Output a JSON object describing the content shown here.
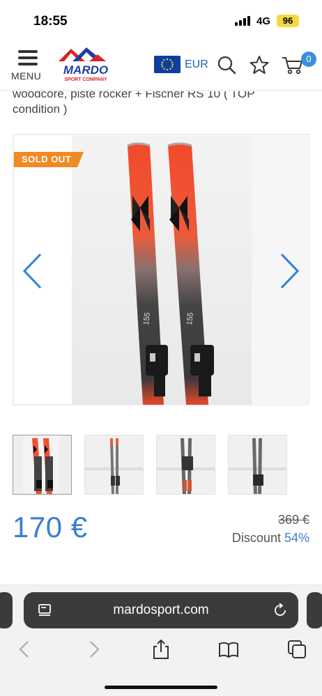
{
  "status_bar": {
    "time": "18:55",
    "network": "4G",
    "battery": "96"
  },
  "header": {
    "menu_label": "MENU",
    "logo_text": "MARDO",
    "logo_subtext": "SPORT COMPANY",
    "currency": "EUR",
    "cart_count": "0",
    "colors": {
      "accent": "#3a7fcf",
      "logo_red": "#d8232a",
      "logo_blue": "#1f3f9e"
    }
  },
  "product": {
    "title_line1": "woodcore, piste rocker + Fischer RS 10 ( TOP",
    "title_line2": "condition )",
    "badge": "SOLD OUT",
    "ski_length": "155",
    "price": "170 €",
    "old_price": "369 €",
    "discount_label": "Discount",
    "discount_value": "54%"
  },
  "gallery": {
    "prev_icon": "chevron-left-icon",
    "next_icon": "chevron-right-icon",
    "thumbnail_count": 4
  },
  "browser": {
    "url": "mardosport.com",
    "icons": [
      "page-menu-icon",
      "reload-icon",
      "back-icon",
      "forward-icon",
      "share-icon",
      "bookmarks-icon",
      "tabs-icon"
    ]
  }
}
